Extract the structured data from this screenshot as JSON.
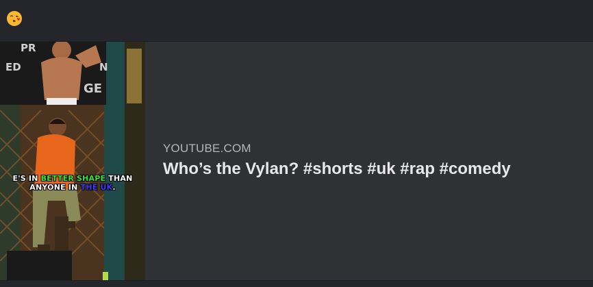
{
  "header": {
    "emoji_icon": "face-blowing-kiss-icon",
    "emoji_char": "😘"
  },
  "link_preview": {
    "site": "YOUTUBE.COM",
    "title": "Who’s the Vylan? #shorts #uk #rap #comedy",
    "thumbnail": {
      "caption_line1_a": "E'S IN ",
      "caption_line1_b": "BETTER SHAPE",
      "caption_line1_c": " THAN",
      "caption_line2_a": "ANYONE IN ",
      "caption_line2_b": "THE UK",
      "caption_line2_c": ".",
      "poster_letters": [
        "PR",
        "ED",
        "N",
        "GE"
      ]
    }
  },
  "colors": {
    "background": "#2b2d31",
    "topbar": "#25262b",
    "site_text": "#b5b6ba",
    "title_text": "#e8e8ea",
    "caption_green": "#39e639",
    "caption_blue": "#3b3bff"
  }
}
